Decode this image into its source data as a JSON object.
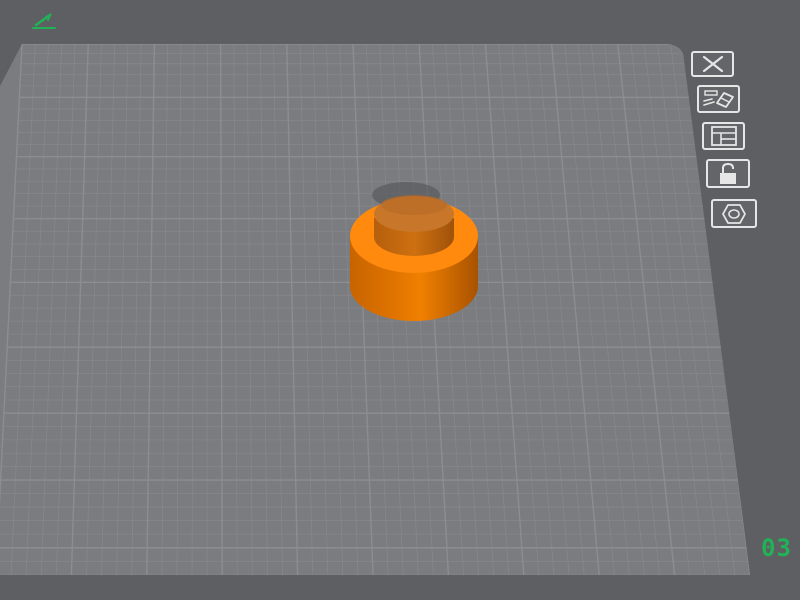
{
  "colors": {
    "background": "#5e5f62",
    "bed": "#7b7c80",
    "grid_line": "#8d8e92",
    "model_orange": "#ff8a0e",
    "status_green": "#22b256",
    "icon_white": "#e6e6e6"
  },
  "icons": {
    "edit": "pencil-icon",
    "close": "close-icon",
    "erase": "eraser-icon",
    "layout": "layout-icon",
    "lock": "unlock-icon",
    "nut": "hex-nut-icon"
  },
  "counter": {
    "text": "03"
  }
}
